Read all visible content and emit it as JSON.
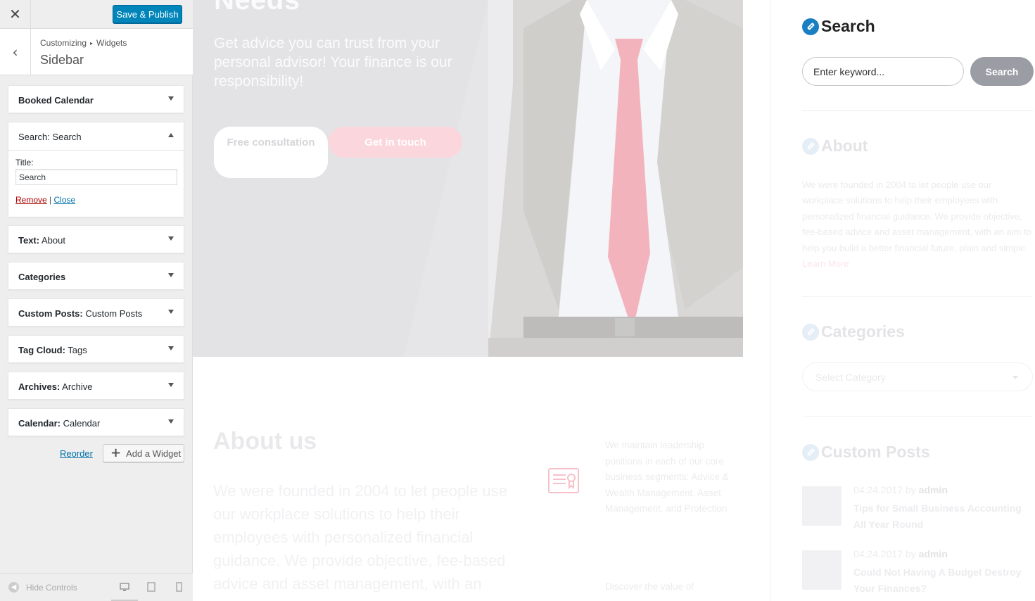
{
  "customizer": {
    "close_icon": "✕",
    "save_label": "Save & Publish",
    "back_icon": "‹",
    "breadcrumb": {
      "root": "Customizing",
      "sep": "▸",
      "current": "Widgets"
    },
    "section_title": "Sidebar",
    "widgets": [
      {
        "type": "Booked Calendar",
        "title": ""
      },
      {
        "type": "Search:",
        "title": " Search",
        "expanded": true
      },
      {
        "type": "Text:",
        "title": " About"
      },
      {
        "type": "Categories",
        "title": ""
      },
      {
        "type": "Custom Posts:",
        "title": " Custom Posts"
      },
      {
        "type": "Tag Cloud:",
        "title": " Tags"
      },
      {
        "type": "Archives:",
        "title": " Archive"
      },
      {
        "type": "Calendar:",
        "title": " Calendar"
      }
    ],
    "search_form": {
      "title_label": "Title:",
      "title_value": "Search",
      "remove": "Remove",
      "sep": "|",
      "close": "Close"
    },
    "reorder": "Reorder",
    "add_widget": "Add a Widget",
    "add_icon": "+",
    "hide_controls": "Hide Controls",
    "hide_icon": "◀"
  },
  "preview": {
    "hero": {
      "heading": "Needs",
      "text": "Get advice you can trust from your personal advisor! Your finance is our responsibility!",
      "btn_free": "Free consultation",
      "btn_touch": "Get in touch"
    },
    "about": {
      "heading": "About us",
      "text": "We were founded in 2004 to let people use our workplace solutions to help their employees with personalized financial guidance. We provide objective, fee-based advice and asset management, with an aim",
      "side_text": "We maintain leadership positions in each of our core business segments: Advice & Wealth Management, Asset Management, and Protection",
      "discover": "Discover the value of"
    },
    "sidebar": {
      "search_heading": "Search",
      "search_placeholder": "Enter keyword...",
      "search_button": "Search",
      "about_heading": "About",
      "about_text": "We were founded in 2004 to let people use our workplace solutions to help their employees with personalized financial guidance. We provide objective, fee-based advice and asset management, with an aim to help you build a better financial future, plain and simple.",
      "about_more": "Learn More",
      "categories_heading": "Categories",
      "categories_select": "Select Category",
      "custom_posts_heading": "Custom Posts",
      "posts": [
        {
          "date": "04.24.2017",
          "by": "by",
          "author": "admin",
          "title": "Tips for Small Business Accounting All Year Round"
        },
        {
          "date": "04.24.2017",
          "by": "by",
          "author": "admin",
          "title": "Could Not Having A Budget Destroy Your Finances?"
        }
      ]
    }
  },
  "colors": {
    "primary": "#0085ba",
    "accent_pink": "#fbd6dc",
    "widget_icon": "#1a7fc1",
    "search_button": "#9a9da3"
  }
}
